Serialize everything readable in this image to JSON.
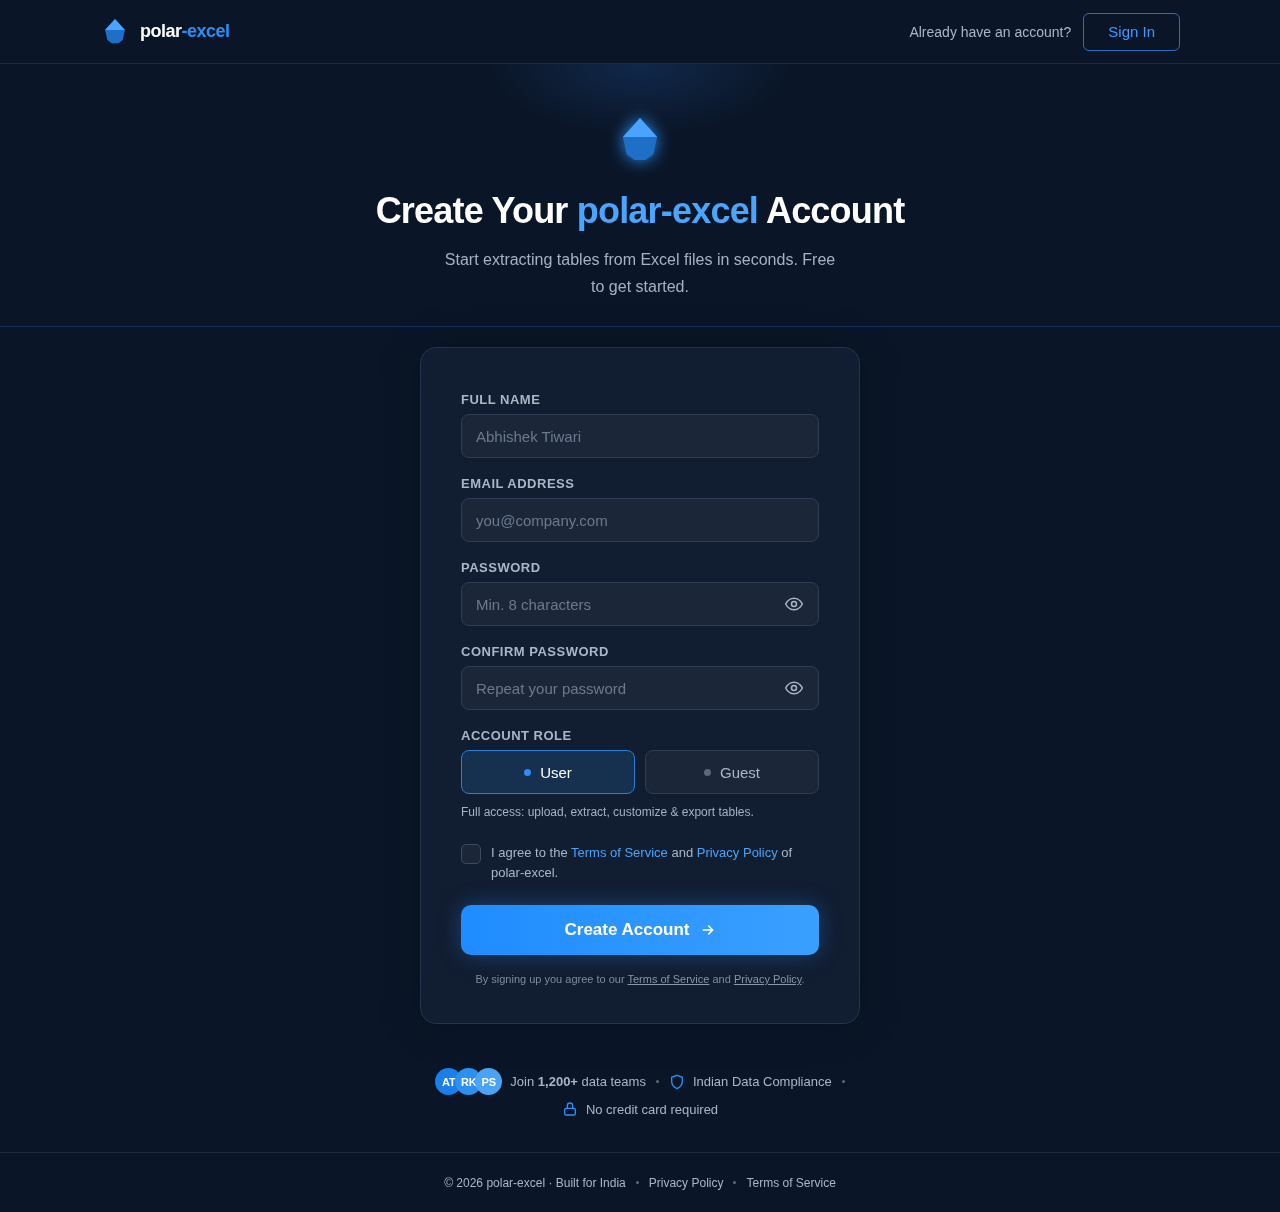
{
  "header": {
    "logo": {
      "part_1": "polar",
      "part_2": "-excel"
    },
    "prompt": "Already have an account?",
    "sign_in": "Sign In"
  },
  "hero": {
    "title": {
      "before": "Create Your ",
      "brand": "polar-excel",
      "after": " Account"
    },
    "subtitle": "Start extracting tables from Excel files in seconds. Free to get started."
  },
  "form": {
    "fields": [
      {
        "label": "FULL NAME",
        "placeholder": "Abhishek Tiwari",
        "kind": "text"
      },
      {
        "label": "EMAIL ADDRESS",
        "placeholder": "you@company.com",
        "kind": "text"
      },
      {
        "label": "PASSWORD",
        "placeholder": "Min. 8 characters",
        "kind": "password"
      },
      {
        "label": "CONFIRM PASSWORD",
        "placeholder": "Repeat your password",
        "kind": "password"
      }
    ],
    "role": {
      "label": "ACCOUNT ROLE",
      "options": [
        {
          "label": "User",
          "selected": true
        },
        {
          "label": "Guest",
          "selected": false
        }
      ],
      "hint": "Full access: upload, extract, customize & export tables."
    },
    "agree": {
      "checked": false,
      "prefix": "I agree to the ",
      "link_1": "Terms of Service",
      "middle": " and ",
      "link_2": "Privacy Policy",
      "suffix": " of polar-excel."
    },
    "submit": "Create Account",
    "legal": {
      "prefix": "By signing up you agree to our ",
      "link_1": "Terms of Service",
      "middle": " and ",
      "link_2": "Privacy Policy",
      "suffix": "."
    }
  },
  "social": {
    "avatars": [
      {
        "initials": "AT",
        "color": "#1a7fe6"
      },
      {
        "initials": "RK",
        "color": "#2b90f0"
      },
      {
        "initials": "PS",
        "color": "#4aa3f5"
      }
    ],
    "teams": "Join **1,200+** data teams",
    "compliance": "Indian Data Compliance",
    "no_card": "No credit card required"
  },
  "footer": {
    "copyright": "© 2026 polar-excel · Built for India",
    "links": [
      "Privacy Policy",
      "Terms of Service"
    ]
  }
}
